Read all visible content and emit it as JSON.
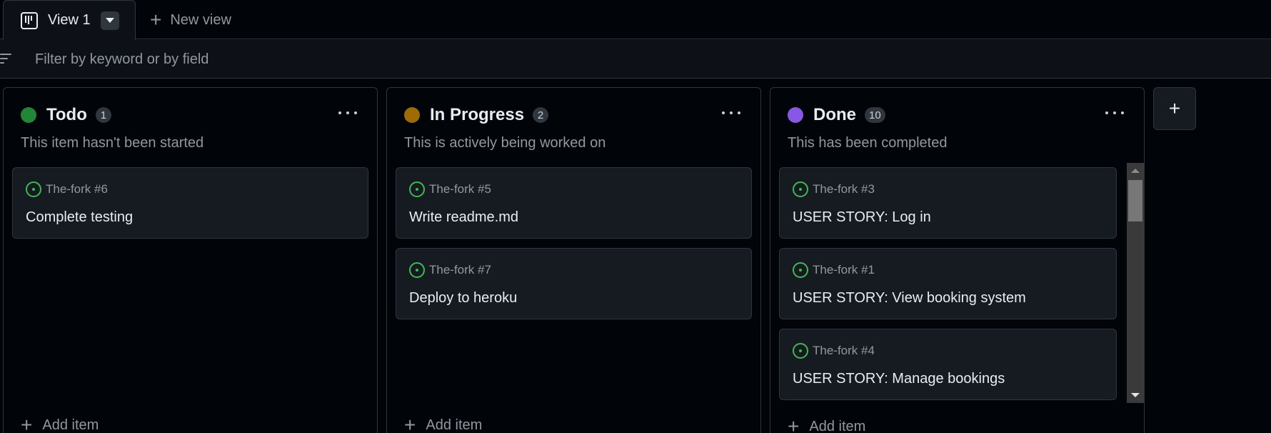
{
  "tabs": {
    "active": {
      "label": "View 1"
    },
    "new_view_label": "New view"
  },
  "filter": {
    "placeholder": "Filter by keyword or by field"
  },
  "columns": [
    {
      "title": "Todo",
      "count": "1",
      "color": "#238636",
      "description": "This item hasn't been started",
      "cards": [
        {
          "ref": "The-fork #6",
          "title": "Complete testing"
        }
      ],
      "add_label": "Add item"
    },
    {
      "title": "In Progress",
      "count": "2",
      "color": "#9e6a03",
      "description": "This is actively being worked on",
      "cards": [
        {
          "ref": "The-fork #5",
          "title": "Write readme.md"
        },
        {
          "ref": "The-fork #7",
          "title": "Deploy to heroku"
        }
      ],
      "add_label": "Add item"
    },
    {
      "title": "Done",
      "count": "10",
      "color": "#8957e5",
      "description": "This has been completed",
      "cards": [
        {
          "ref": "The-fork #3",
          "title": "USER STORY: Log in"
        },
        {
          "ref": "The-fork #1",
          "title": "USER STORY: View booking system"
        },
        {
          "ref": "The-fork #4",
          "title": "USER STORY: Manage bookings"
        }
      ],
      "add_label": "Add item"
    }
  ],
  "add_column_label": "+",
  "icons": {
    "board": "project-board-icon",
    "plus": "plus-icon",
    "filter": "filter-icon",
    "issue_open": "issue-opened-icon",
    "kebab": "kebab-horizontal-icon"
  }
}
